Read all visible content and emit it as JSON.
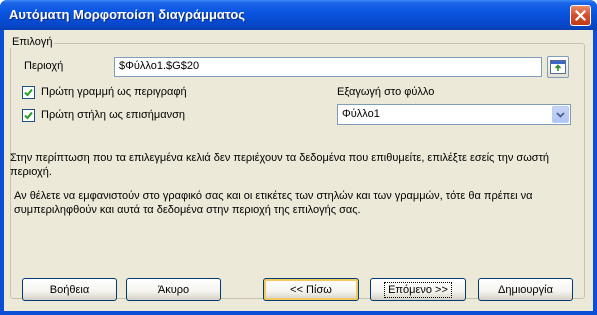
{
  "window": {
    "title": "Αυτόματη Μορφοποίση διαγράμματος"
  },
  "group": {
    "label": "Επιλογή"
  },
  "range": {
    "label": "Περιοχή",
    "value": "$Φύλλο1.$G$20"
  },
  "options": {
    "first_row_label": "Πρώτη γραμμή ως περιγραφή",
    "first_row_checked": true,
    "first_column_label": "Πρώτη στήλη ως επισήμανση",
    "first_column_checked": true
  },
  "output": {
    "label": "Εξαγωγή στο φύλλο",
    "selected": "Φύλλο1"
  },
  "info": {
    "paragraph1": "Στην περίπτωση που τα επιλεγμένα κελιά δεν περιέχουν τα δεδομένα που επιθυμείτε, επιλέξτε εσείς την σωστή περιοχή.",
    "paragraph2": "Αν θέλετε να εμφανιστούν στο γραφικό σας και οι ετικέτες των στηλών και των γραμμών, τότε θα πρέπει να συμπεριληφθούν και αυτά τα δεδομένα στην περιοχή της επιλογής σας."
  },
  "buttons": {
    "help": "Βοήθεια",
    "cancel": "Άκυρο",
    "back": "<< Πίσω",
    "next": "Επόμενο >>",
    "create": "Δημιουργία"
  }
}
